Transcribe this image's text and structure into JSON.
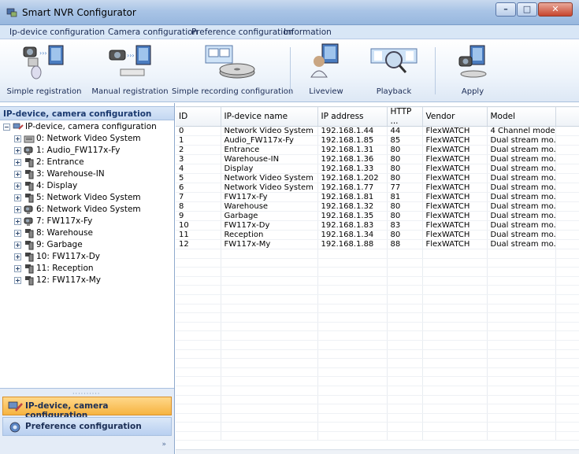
{
  "window": {
    "title": "Smart NVR Configurator"
  },
  "menu": [
    "Ip-device configuration",
    "Camera configuration",
    "Preference configuration",
    "Information"
  ],
  "toolbar": {
    "buttons": [
      {
        "label": "Simple registration",
        "icon": "simple-registration-icon"
      },
      {
        "label": "Manual registration",
        "icon": "manual-registration-icon"
      },
      {
        "label": "Simple recording configuration",
        "icon": "recording-config-icon"
      },
      {
        "label": "Liveview",
        "icon": "liveview-icon"
      },
      {
        "label": "Playback",
        "icon": "playback-icon"
      },
      {
        "label": "Apply",
        "icon": "apply-icon"
      }
    ]
  },
  "left_panel": {
    "header": "IP-device, camera configuration",
    "tree_root": "IP-device, camera configuration",
    "tree_items": [
      "0: Network Video System",
      "1: Audio_FW117x-Fy",
      "2: Entrance",
      "3: Warehouse-IN",
      "4: Display",
      "5: Network Video System",
      "6: Network Video System",
      "7: FW117x-Fy",
      "8: Warehouse",
      "9: Garbage",
      "10: FW117x-Dy",
      "11: Reception",
      "12: FW117x-My"
    ],
    "nav_active": "IP-device, camera configuration",
    "nav_other": "Preference configuration",
    "chevron": "»"
  },
  "table": {
    "columns": [
      "ID",
      "IP-device name",
      "IP address",
      "HTTP ...",
      "Vendor",
      "Model"
    ],
    "rows": [
      [
        "0",
        "Network Video System",
        "192.168.1.44",
        "44",
        "FlexWATCH",
        "4 Channel model"
      ],
      [
        "1",
        "Audio_FW117x-Fy",
        "192.168.1.85",
        "85",
        "FlexWATCH",
        "Dual stream mo..."
      ],
      [
        "2",
        "Entrance",
        "192.168.1.31",
        "80",
        "FlexWATCH",
        "Dual stream mo..."
      ],
      [
        "3",
        "Warehouse-IN",
        "192.168.1.36",
        "80",
        "FlexWATCH",
        "Dual stream mo..."
      ],
      [
        "4",
        "Display",
        "192.168.1.33",
        "80",
        "FlexWATCH",
        "Dual stream mo..."
      ],
      [
        "5",
        "Network Video System",
        "192.168.1.202",
        "80",
        "FlexWATCH",
        "Dual stream mo..."
      ],
      [
        "6",
        "Network Video System",
        "192.168.1.77",
        "77",
        "FlexWATCH",
        "Dual stream mo..."
      ],
      [
        "7",
        "FW117x-Fy",
        "192.168.1.81",
        "81",
        "FlexWATCH",
        "Dual stream mo..."
      ],
      [
        "8",
        "Warehouse",
        "192.168.1.32",
        "80",
        "FlexWATCH",
        "Dual stream mo..."
      ],
      [
        "9",
        "Garbage",
        "192.168.1.35",
        "80",
        "FlexWATCH",
        "Dual stream mo..."
      ],
      [
        "10",
        "FW117x-Dy",
        "192.168.1.83",
        "83",
        "FlexWATCH",
        "Dual stream mo..."
      ],
      [
        "11",
        "Reception",
        "192.168.1.34",
        "80",
        "FlexWATCH",
        "Dual stream mo..."
      ],
      [
        "12",
        "FW117x-My",
        "192.168.1.88",
        "88",
        "FlexWATCH",
        "Dual stream mo..."
      ]
    ]
  },
  "colors": {
    "accent": "#f6b340",
    "header_blue": "#c4d8f2",
    "titlebar": "#a9c4e6"
  }
}
